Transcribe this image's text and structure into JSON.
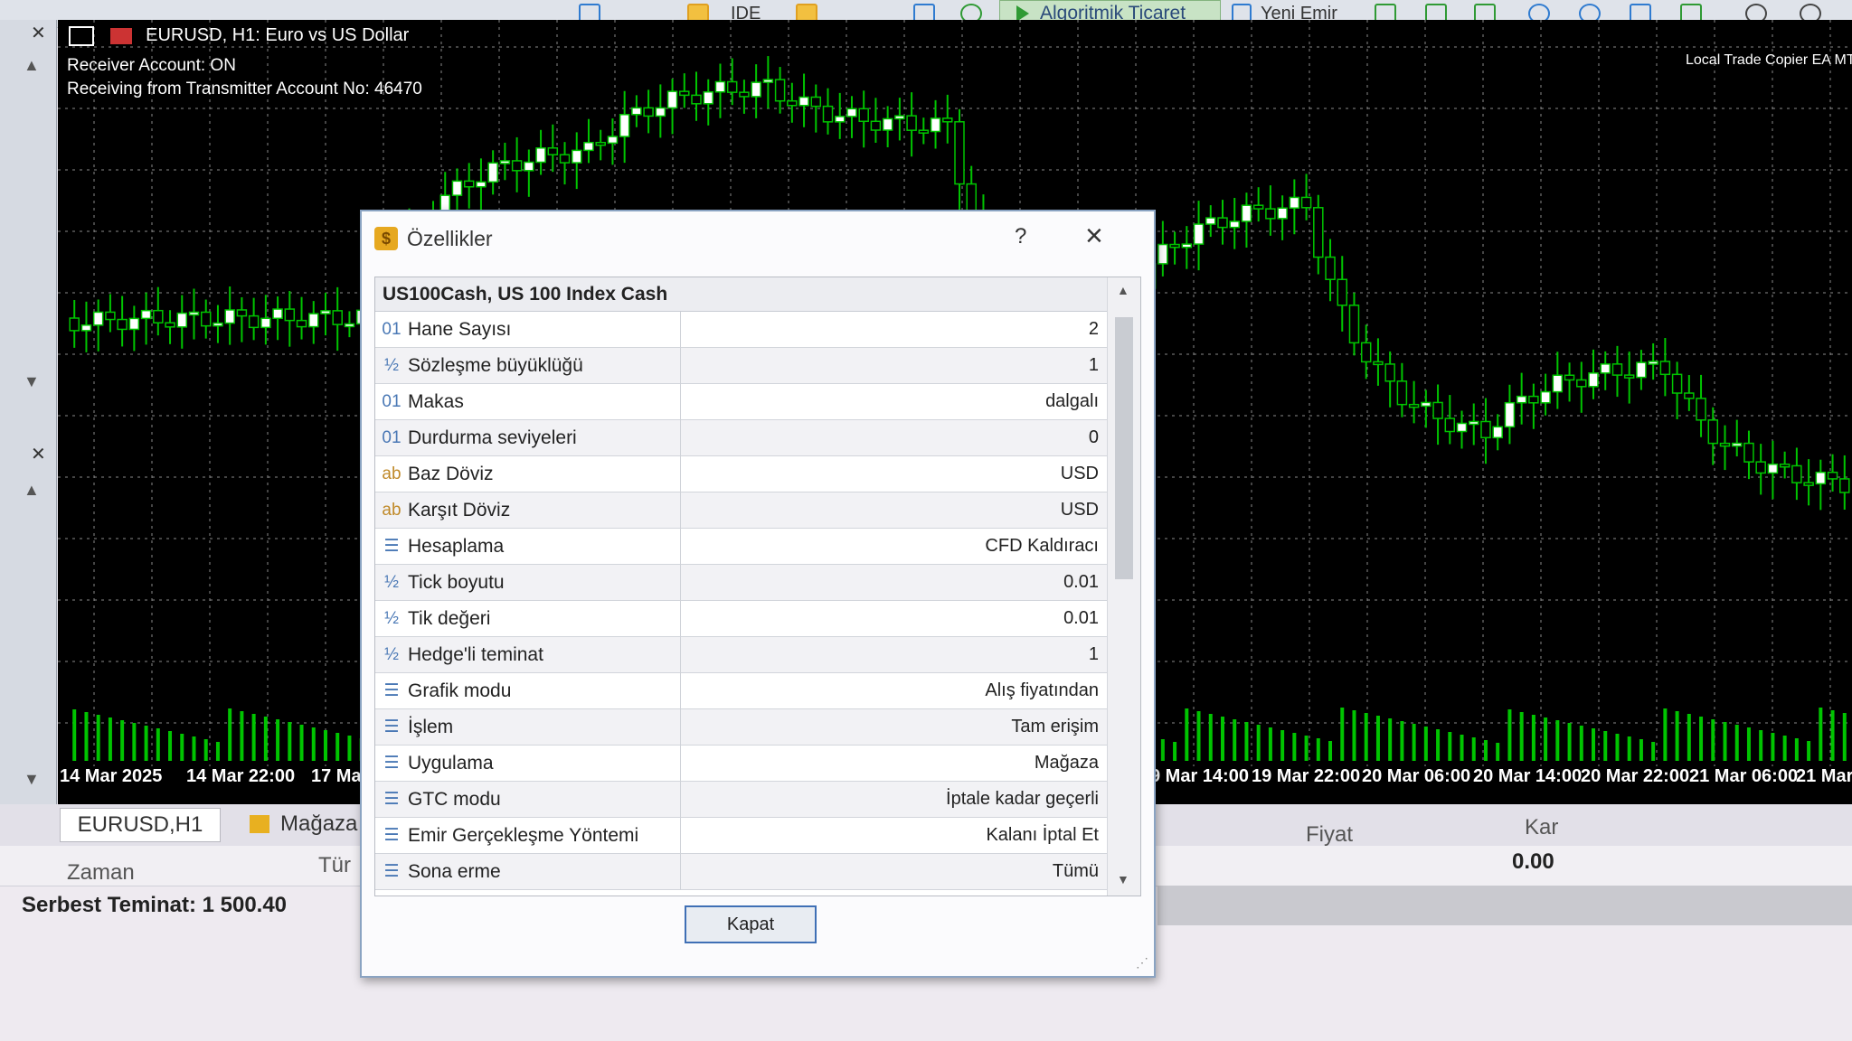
{
  "toolbar": {
    "items": [
      "IDE",
      "Algoritmik Ticaret",
      "Yeni Emir"
    ]
  },
  "chart": {
    "title": "EURUSD, H1:  Euro vs US Dollar",
    "info_line1": "Receiver Account: ON",
    "info_line2": "Receiving from Transmitter Account No: 46470",
    "ea_label": "Local Trade Copier EA MT",
    "colors": {
      "bull": "#00c400",
      "bear": "#ffffff",
      "grid": "#8a8a8a"
    },
    "time_labels": [
      "14 Mar 2025",
      "14 Mar 22:00",
      "17 Ma",
      "9 Mar 14:00",
      "19 Mar 22:00",
      "20 Mar 06:00",
      "20 Mar 14:00",
      "20 Mar 22:00",
      "21 Mar 06:00",
      "21 Mar"
    ]
  },
  "bottom": {
    "tab_chart": "EURUSD,H1",
    "tab_store": "Mağaza",
    "col_time": "Zaman",
    "col_type": "Tür",
    "col_price": "Fiyat",
    "col_profit": "Kar",
    "profit_value": "0.00",
    "free_margin": "Serbest Teminat: 1 500.40"
  },
  "dialog": {
    "title": "Özellikler",
    "help": "?",
    "close": "×",
    "header": "US100Cash, US 100 Index Cash",
    "rows": [
      {
        "icon": "01",
        "name": "Hane Sayısı",
        "value": "2"
      },
      {
        "icon": "½",
        "name": "Sözleşme büyüklüğü",
        "value": "1"
      },
      {
        "icon": "01",
        "name": "Makas",
        "value": "dalgalı"
      },
      {
        "icon": "01",
        "name": "Durdurma seviyeleri",
        "value": "0"
      },
      {
        "icon": "ab",
        "name": "Baz Döviz",
        "value": "USD"
      },
      {
        "icon": "ab",
        "name": "Karşıt Döviz",
        "value": "USD"
      },
      {
        "icon": "☰",
        "name": "Hesaplama",
        "value": "CFD Kaldıracı"
      },
      {
        "icon": "½",
        "name": "Tick boyutu",
        "value": "0.01"
      },
      {
        "icon": "½",
        "name": "Tik değeri",
        "value": "0.01"
      },
      {
        "icon": "½",
        "name": "Hedge'li teminat",
        "value": "1"
      },
      {
        "icon": "☰",
        "name": "Grafik modu",
        "value": "Alış fiyatından"
      },
      {
        "icon": "☰",
        "name": "İşlem",
        "value": "Tam erişim"
      },
      {
        "icon": "☰",
        "name": "Uygulama",
        "value": "Mağaza"
      },
      {
        "icon": "☰",
        "name": "GTC modu",
        "value": "İptale kadar geçerli"
      },
      {
        "icon": "☰",
        "name": "Emir Gerçekleşme Yöntemi",
        "value": "Kalanı İptal Et"
      },
      {
        "icon": "☰",
        "name": "Sona erme",
        "value": "Tümü"
      }
    ],
    "button": "Kapat"
  }
}
